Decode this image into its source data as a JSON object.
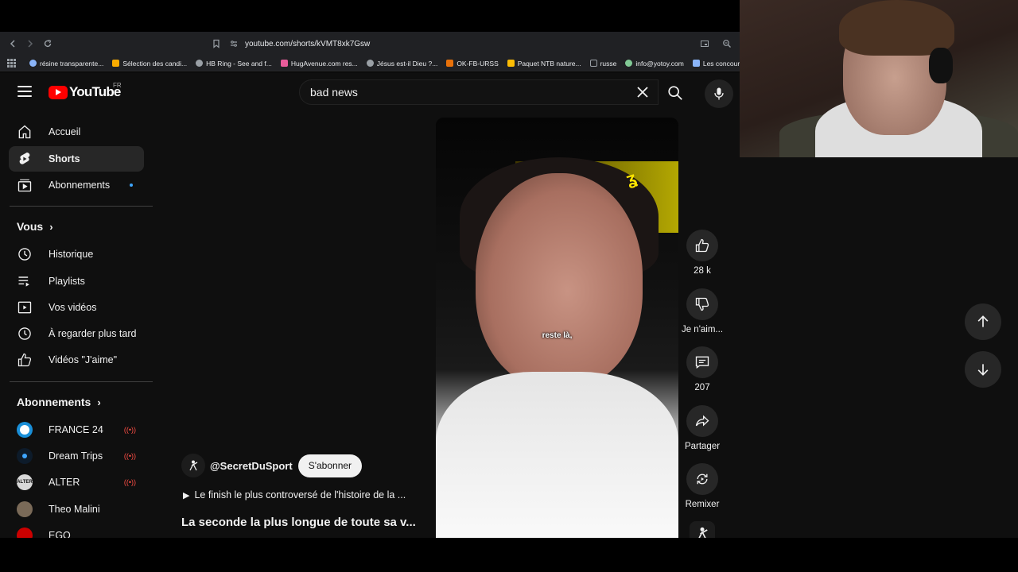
{
  "browser": {
    "url": "youtube.com/shorts/kVMT8xk7Gsw",
    "bookmarks": [
      {
        "label": "résine transparente...",
        "color": "#8ab4f8"
      },
      {
        "label": "Sélection des candi...",
        "color": "#f9ab00"
      },
      {
        "label": "HB Ring - See and f...",
        "color": "#9aa0a6"
      },
      {
        "label": "HugAvenue.com res...",
        "color": "#e85c9a"
      },
      {
        "label": "Jésus est-il Dieu ?...",
        "color": "#9aa0a6"
      },
      {
        "label": "OK-FB-URSS",
        "color": "#e8710a"
      },
      {
        "label": "Paquet NTB nature...",
        "color": "#fbbc04"
      },
      {
        "label": "russe",
        "color": "#9aa0a6"
      },
      {
        "label": "info@yotoy.com",
        "color": "#81c995"
      },
      {
        "label": "Les concours d'a",
        "color": "#8ab4f8"
      }
    ]
  },
  "youtube": {
    "logo_text": "YouTube",
    "country": "FR",
    "search_value": "bad news"
  },
  "sidebar": {
    "main": [
      {
        "label": "Accueil"
      },
      {
        "label": "Shorts"
      },
      {
        "label": "Abonnements"
      }
    ],
    "you_heading": "Vous",
    "you_items": [
      {
        "label": "Historique"
      },
      {
        "label": "Playlists"
      },
      {
        "label": "Vos vidéos"
      },
      {
        "label": "À regarder plus tard"
      },
      {
        "label": "Vidéos \"J'aime\""
      }
    ],
    "subs_heading": "Abonnements",
    "subscriptions": [
      {
        "label": "FRANCE 24",
        "live": true,
        "color": "#1a8fd8"
      },
      {
        "label": "Dream Trips",
        "live": true,
        "color": "#0d1b2a"
      },
      {
        "label": "ALTER",
        "live": true,
        "color": "#d8d8d8"
      },
      {
        "label": "Theo Malini",
        "live": false,
        "color": "#7a6a58"
      },
      {
        "label": "EGO",
        "live": false,
        "color": "#cc0000"
      }
    ]
  },
  "short": {
    "caption": "reste là,",
    "channel": "@SecretDuSport",
    "subscribe_label": "S'abonner",
    "playlist": "Le finish le plus controversé de l'histoire de la ...",
    "title": "La seconde la plus longue de toute sa v..."
  },
  "actions": {
    "likes": "28 k",
    "dislike_label": "Je n'aim...",
    "comments": "207",
    "share_label": "Partager",
    "remix_label": "Remixer"
  }
}
